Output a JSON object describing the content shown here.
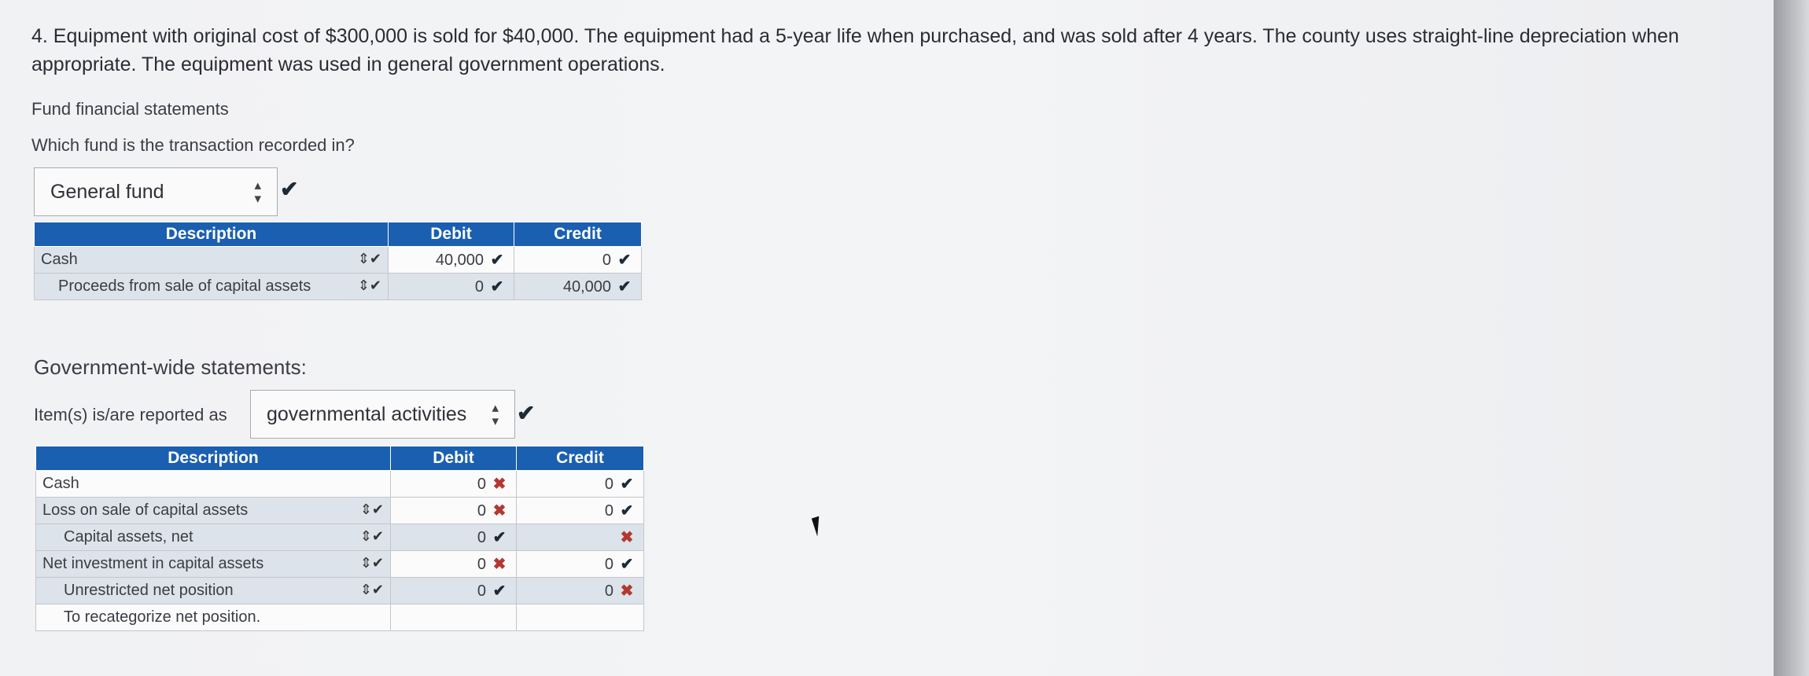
{
  "question": "4. Equipment with original cost of $300,000 is sold for $40,000. The equipment had a 5-year life when purchased, and was sold after 4 years. The county uses straight-line depreciation when appropriate. The equipment was used in general government operations.",
  "fund": {
    "heading": "Fund financial statements",
    "prompt": "Which fund is the transaction recorded in?",
    "select_value": "General fund",
    "select_mark": "✔",
    "table": {
      "headers": [
        "Description",
        "Debit",
        "Credit"
      ],
      "rows": [
        {
          "desc": "Cash",
          "debit": "40,000",
          "debit_mark": "✔",
          "credit": "0",
          "credit_mark": "✔"
        },
        {
          "desc": "Proceeds from sale of capital assets",
          "debit": "0",
          "debit_mark": "✔",
          "credit": "40,000",
          "credit_mark": "✔"
        }
      ]
    }
  },
  "gov": {
    "heading": "Government-wide statements:",
    "prompt": "Item(s) is/are reported as",
    "select_value": "governmental activities",
    "select_mark": "✔",
    "table": {
      "headers": [
        "Description",
        "Debit",
        "Credit"
      ],
      "rows": [
        {
          "desc": "Cash",
          "debit": "0",
          "debit_mark": "✖",
          "credit": "0",
          "credit_mark": "✔"
        },
        {
          "desc": "Loss on sale of capital assets",
          "debit": "0",
          "debit_mark": "✖",
          "credit": "0",
          "credit_mark": "✔"
        },
        {
          "desc": "Capital assets, net",
          "debit": "0",
          "debit_mark": "✔",
          "credit": "",
          "credit_mark": "✖"
        },
        {
          "desc": "Net investment in capital assets",
          "debit": "0",
          "debit_mark": "✖",
          "credit": "0",
          "credit_mark": "✔"
        },
        {
          "desc": "Unrestricted net position",
          "debit": "0",
          "debit_mark": "✔",
          "credit": "0",
          "credit_mark": "✖"
        },
        {
          "desc": "To recategorize net position.",
          "debit": "",
          "debit_mark": "",
          "credit": "",
          "credit_mark": ""
        }
      ]
    }
  },
  "colors": {
    "header_blue": "#1a5fb0",
    "ok": "#1e2a36",
    "wrong": "#b3382f"
  },
  "icons": {
    "dropdown": "updown-arrows-icon",
    "correct": "check-icon",
    "incorrect": "x-icon"
  }
}
